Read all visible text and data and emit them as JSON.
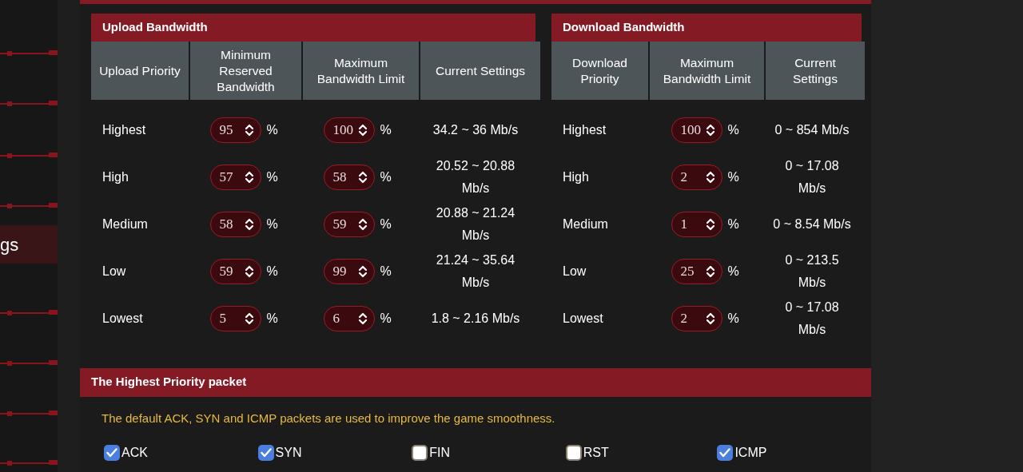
{
  "sidebar": {
    "items": [
      {
        "label": "gs",
        "selected": true
      }
    ]
  },
  "upload": {
    "title": "Upload Bandwidth",
    "columns": [
      "Upload Priority",
      "Minimum Reserved Bandwidth",
      "Maximum Bandwidth Limit",
      "Current Settings"
    ],
    "rows": [
      {
        "priority": "Highest",
        "min": "95",
        "max": "100",
        "current": "34.2 ~ 36 Mb/s"
      },
      {
        "priority": "High",
        "min": "57",
        "max": "58",
        "current": "20.52 ~ 20.88 Mb/s"
      },
      {
        "priority": "Medium",
        "min": "58",
        "max": "59",
        "current": "20.88 ~ 21.24 Mb/s"
      },
      {
        "priority": "Low",
        "min": "59",
        "max": "99",
        "current": "21.24 ~ 35.64 Mb/s"
      },
      {
        "priority": "Lowest",
        "min": "5",
        "max": "6",
        "current": "1.8 ~ 2.16 Mb/s"
      }
    ]
  },
  "download": {
    "title": "Download Bandwidth",
    "columns": [
      "Download Priority",
      "Maximum Bandwidth Limit",
      "Current Settings"
    ],
    "rows": [
      {
        "priority": "Highest",
        "max": "100",
        "current": "0 ~ 854 Mb/s"
      },
      {
        "priority": "High",
        "max": "2",
        "current": "0 ~ 17.08 Mb/s"
      },
      {
        "priority": "Medium",
        "max": "1",
        "current": "0 ~ 8.54 Mb/s"
      },
      {
        "priority": "Low",
        "max": "25",
        "current": "0 ~ 213.5 Mb/s"
      },
      {
        "priority": "Lowest",
        "max": "2",
        "current": "0 ~ 17.08 Mb/s"
      }
    ]
  },
  "unit": "%",
  "priority_packet": {
    "title": "The Highest Priority packet",
    "description": "The default ACK, SYN and ICMP packets are used to improve the game smoothness.",
    "options": [
      {
        "label": "ACK",
        "checked": true
      },
      {
        "label": "SYN",
        "checked": true
      },
      {
        "label": "FIN",
        "checked": false
      },
      {
        "label": "RST",
        "checked": false
      },
      {
        "label": "ICMP",
        "checked": true
      }
    ]
  }
}
